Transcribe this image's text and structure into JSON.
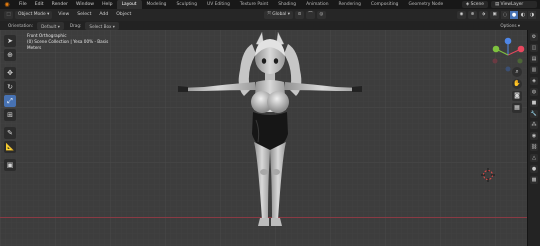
{
  "app": {
    "menus": [
      "File",
      "Edit",
      "Render",
      "Window",
      "Help"
    ],
    "workspaces": [
      "Layout",
      "Modeling",
      "Sculpting",
      "UV Editing",
      "Texture Paint",
      "Shading",
      "Animation",
      "Rendering",
      "Compositing",
      "Geometry Node"
    ],
    "active_workspace": "Layout",
    "scene": "Scene",
    "view_layer": "ViewLayer"
  },
  "header": {
    "mode": "Object Mode",
    "menus": [
      "View",
      "Select",
      "Add",
      "Object"
    ],
    "transform_orientation": "Global"
  },
  "tool_settings": {
    "orientation_label": "Orientation:",
    "orientation_value": "Default",
    "drag_label": "Drag:",
    "drag_value": "Select Box",
    "options_label": "Options"
  },
  "viewport": {
    "view_name": "Front Orthographic",
    "collection_info": "(0) Scene Collection | Yesa 00% - Basis",
    "units": "Meters"
  },
  "colors": {
    "viewport_bg": "#3d3d3d",
    "accent": "#4772b3",
    "x_axis": "#e8475e",
    "y_axis": "#7ec23f",
    "z_axis": "#4f87e8",
    "brand": "#e87d0d"
  },
  "icons": {
    "left_tools": [
      "cursor-select-icon",
      "3d-cursor-icon",
      "move-icon",
      "rotate-icon",
      "scale-icon",
      "transform-icon",
      "annotate-icon",
      "measure-icon",
      "add-cube-icon"
    ],
    "nav": [
      "zoom-icon",
      "hand-pan-icon",
      "camera-icon",
      "perspective-grid-icon"
    ]
  }
}
